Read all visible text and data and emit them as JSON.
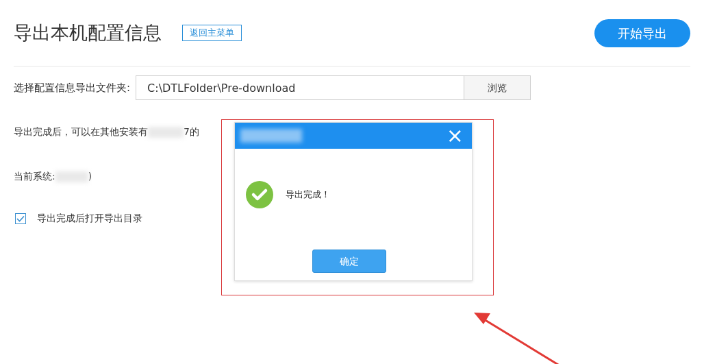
{
  "header": {
    "title": "导出本机配置信息",
    "back_button": "返回主菜单",
    "start_button": "开始导出"
  },
  "folder": {
    "label": "选择配置信息导出文件夹:",
    "value": "C:\\DTLFolder\\Pre-download",
    "browse_button": "浏览"
  },
  "info": {
    "before": "导出完成后，可以在其他安装有",
    "after": "7的"
  },
  "system": {
    "label": "当前系统:",
    "after": ")"
  },
  "open_folder": {
    "label": "导出完成后打开导出目录",
    "checked": true
  },
  "dialog": {
    "close": "×",
    "message": "导出完成！",
    "ok_button": "确定"
  }
}
